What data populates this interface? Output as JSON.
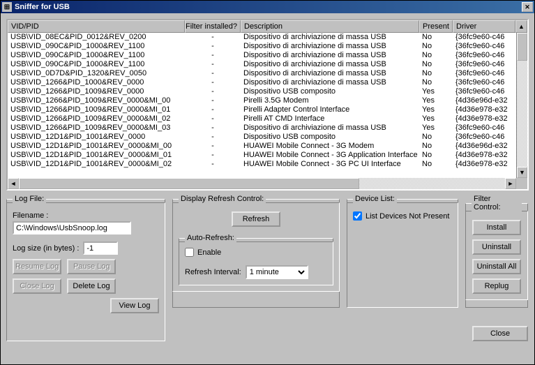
{
  "window": {
    "title": "Sniffer for USB"
  },
  "columns": {
    "vidpid": "VID/PID",
    "filter": "Filter installed?",
    "description": "Description",
    "present": "Present",
    "driver": "Driver"
  },
  "rows": [
    {
      "vidpid": "USB\\VID_08EC&PID_0012&REV_0200",
      "filter": "-",
      "desc": "Dispositivo di archiviazione di massa USB",
      "present": "No",
      "driver": "{36fc9e60-c46"
    },
    {
      "vidpid": "USB\\VID_090C&PID_1000&REV_1100",
      "filter": "-",
      "desc": "Dispositivo di archiviazione di massa USB",
      "present": "No",
      "driver": "{36fc9e60-c46"
    },
    {
      "vidpid": "USB\\VID_090C&PID_1000&REV_1100",
      "filter": "-",
      "desc": "Dispositivo di archiviazione di massa USB",
      "present": "No",
      "driver": "{36fc9e60-c46"
    },
    {
      "vidpid": "USB\\VID_090C&PID_1000&REV_1100",
      "filter": "-",
      "desc": "Dispositivo di archiviazione di massa USB",
      "present": "No",
      "driver": "{36fc9e60-c46"
    },
    {
      "vidpid": "USB\\VID_0D7D&PID_1320&REV_0050",
      "filter": "-",
      "desc": "Dispositivo di archiviazione di massa USB",
      "present": "No",
      "driver": "{36fc9e60-c46"
    },
    {
      "vidpid": "USB\\VID_1266&PID_1000&REV_0000",
      "filter": "-",
      "desc": "Dispositivo di archiviazione di massa USB",
      "present": "No",
      "driver": "{36fc9e60-c46"
    },
    {
      "vidpid": "USB\\VID_1266&PID_1009&REV_0000",
      "filter": "-",
      "desc": "Dispositivo USB composito",
      "present": "Yes",
      "driver": "{36fc9e60-c46"
    },
    {
      "vidpid": "USB\\VID_1266&PID_1009&REV_0000&MI_00",
      "filter": "-",
      "desc": "Pirelli 3.5G Modem",
      "present": "Yes",
      "driver": "{4d36e96d-e32"
    },
    {
      "vidpid": "USB\\VID_1266&PID_1009&REV_0000&MI_01",
      "filter": "-",
      "desc": "Pirelli Adapter Control Interface",
      "present": "Yes",
      "driver": "{4d36e978-e32"
    },
    {
      "vidpid": "USB\\VID_1266&PID_1009&REV_0000&MI_02",
      "filter": "-",
      "desc": "Pirelli AT CMD Interface",
      "present": "Yes",
      "driver": "{4d36e978-e32"
    },
    {
      "vidpid": "USB\\VID_1266&PID_1009&REV_0000&MI_03",
      "filter": "-",
      "desc": "Dispositivo di archiviazione di massa USB",
      "present": "Yes",
      "driver": "{36fc9e60-c46"
    },
    {
      "vidpid": "USB\\VID_12D1&PID_1001&REV_0000",
      "filter": "-",
      "desc": "Dispositivo USB composito",
      "present": "No",
      "driver": "{36fc9e60-c46"
    },
    {
      "vidpid": "USB\\VID_12D1&PID_1001&REV_0000&MI_00",
      "filter": "-",
      "desc": "HUAWEI Mobile Connect - 3G Modem",
      "present": "No",
      "driver": "{4d36e96d-e32"
    },
    {
      "vidpid": "USB\\VID_12D1&PID_1001&REV_0000&MI_01",
      "filter": "-",
      "desc": "HUAWEI Mobile Connect - 3G Application Interface",
      "present": "No",
      "driver": "{4d36e978-e32"
    },
    {
      "vidpid": "USB\\VID_12D1&PID_1001&REV_0000&MI_02",
      "filter": "-",
      "desc": "HUAWEI Mobile Connect - 3G PC UI Interface",
      "present": "No",
      "driver": "{4d36e978-e32"
    }
  ],
  "logfile": {
    "legend": "Log File:",
    "filename_label": "Filename :",
    "filename": "C:\\Windows\\UsbSnoop.log",
    "logsize_label": "Log size (in bytes) :",
    "logsize": "-1",
    "resume": "Resume Log",
    "pause": "Pause Log",
    "close": "Close Log",
    "delete": "Delete Log",
    "view": "View Log"
  },
  "refresh": {
    "legend": "Display Refresh Control:",
    "refresh_btn": "Refresh",
    "auto_legend": "Auto-Refresh:",
    "enable": "Enable",
    "interval_label": "Refresh Interval:",
    "interval_value": "1 minute"
  },
  "devicelist": {
    "legend": "Device List:",
    "checkbox": "List Devices Not Present"
  },
  "filter": {
    "legend": "Filter Control:",
    "install": "Install",
    "uninstall": "Uninstall",
    "uninstall_all": "Uninstall All",
    "replug": "Replug"
  },
  "close_btn": "Close"
}
